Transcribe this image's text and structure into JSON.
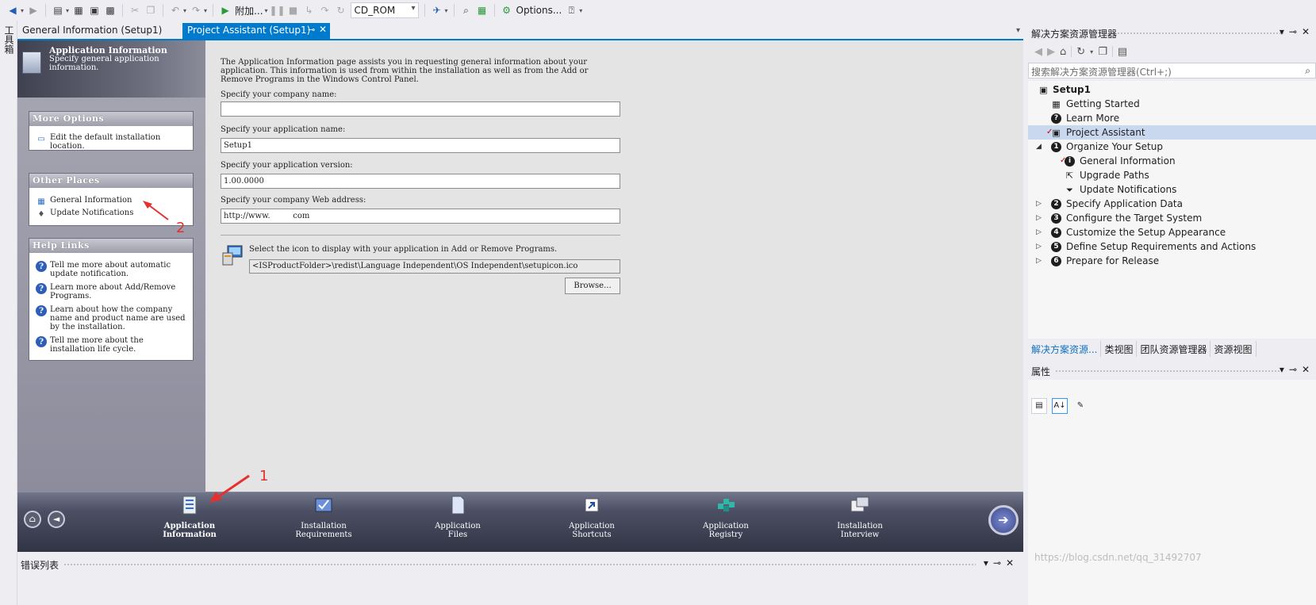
{
  "toolbar": {
    "attach_label": "附加...",
    "config_value": "CD_ROM",
    "options_label": "Options..."
  },
  "toolbox_strip_label": "工具箱",
  "tabs": [
    {
      "label": "General Information (Setup1)",
      "active": false
    },
    {
      "label": "Project Assistant (Setup1)",
      "active": true
    }
  ],
  "left_panel": {
    "title": "Application Information",
    "subtitle": "Specify general application information.",
    "more_options": {
      "heading": "More Options",
      "items": [
        "Edit the default installation location."
      ]
    },
    "other_places": {
      "heading": "Other Places",
      "items": [
        "General Information",
        "Update Notifications"
      ]
    },
    "help_links": {
      "heading": "Help Links",
      "items": [
        "Tell me more about automatic update notification.",
        "Learn more about Add/Remove Programs.",
        "Learn about how the company name and product name are used by the installation.",
        "Tell me more about the installation life cycle."
      ]
    }
  },
  "main": {
    "intro": "The Application Information page assists you in requesting general information about your application. This information is used from within the installation as well as from the Add or Remove Programs in the Windows Control Panel.",
    "company_name_label": "Specify your company name:",
    "company_name_value": "",
    "app_name_label": "Specify your application name:",
    "app_name_value": "Setup1",
    "app_version_label": "Specify your application version:",
    "app_version_value": "1.00.0000",
    "web_address_label": "Specify your company Web address:",
    "web_address_value": "http://www.         com",
    "icon_label": "Select the icon to display with your application in Add or Remove Programs.",
    "icon_path": "<ISProductFolder>\\redist\\Language Independent\\OS Independent\\setupicon.ico",
    "browse_label": "Browse..."
  },
  "nav": {
    "items": [
      {
        "line1": "Application",
        "line2": "Information",
        "active": true
      },
      {
        "line1": "Installation",
        "line2": "Requirements",
        "active": false
      },
      {
        "line1": "Application",
        "line2": "Files",
        "active": false
      },
      {
        "line1": "Application",
        "line2": "Shortcuts",
        "active": false
      },
      {
        "line1": "Application",
        "line2": "Registry",
        "active": false
      },
      {
        "line1": "Installation",
        "line2": "Interview",
        "active": false
      }
    ]
  },
  "error_list_label": "错误列表",
  "solution_explorer": {
    "title": "解决方案资源管理器",
    "search_placeholder": "搜索解决方案资源管理器(Ctrl+;)",
    "tree": {
      "root": "Setup1",
      "getting_started": "Getting Started",
      "learn_more": "Learn More",
      "project_assistant": "Project Assistant",
      "organize": "Organize Your Setup",
      "general_information": "General Information",
      "upgrade_paths": "Upgrade Paths",
      "update_notifications": "Update Notifications",
      "specify_data": "Specify Application Data",
      "configure_target": "Configure the Target System",
      "customize": "Customize the Setup Appearance",
      "define_req": "Define Setup Requirements and Actions",
      "prepare": "Prepare for Release"
    },
    "bottom_tabs": [
      "解决方案资源...",
      "类视图",
      "团队资源管理器",
      "资源视图"
    ]
  },
  "properties": {
    "title": "属性"
  },
  "watermark": "https://blog.csdn.net/qq_31492707",
  "annotations": [
    "1",
    "2"
  ],
  "colors": {
    "accent": "#007acc",
    "selection": "#c9d8ef",
    "annotation": "#e53030"
  }
}
